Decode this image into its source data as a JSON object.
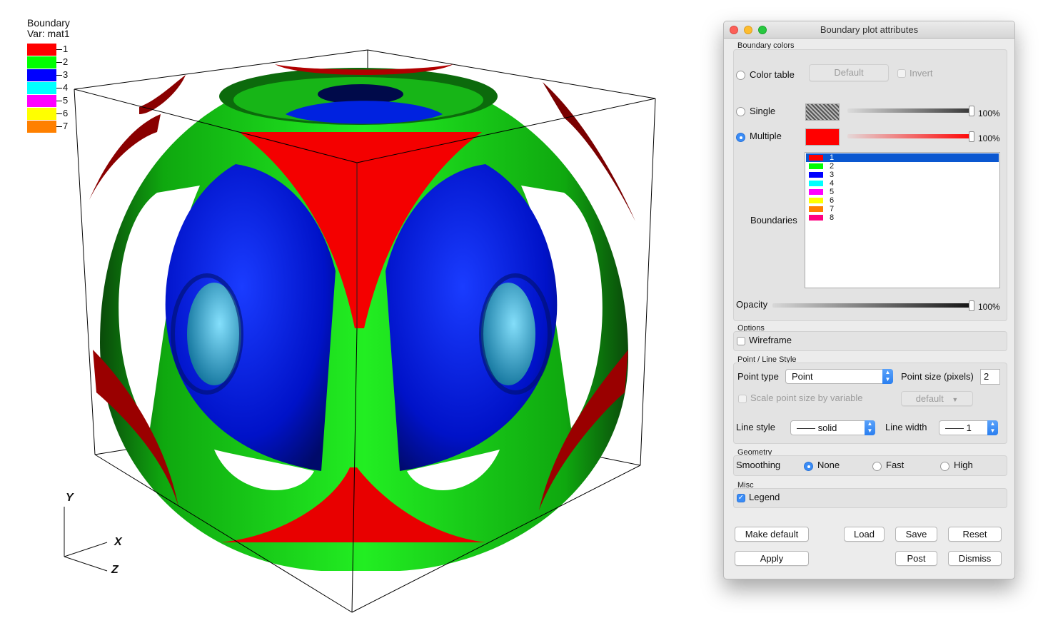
{
  "legend": {
    "title": "Boundary",
    "variable": "Var: mat1",
    "entries": [
      {
        "label": "1",
        "color": "#ff0000"
      },
      {
        "label": "2",
        "color": "#00ff00"
      },
      {
        "label": "3",
        "color": "#0000ff"
      },
      {
        "label": "4",
        "color": "#00ffff"
      },
      {
        "label": "5",
        "color": "#ff00ff"
      },
      {
        "label": "6",
        "color": "#ffff00"
      },
      {
        "label": "7",
        "color": "#ff8000"
      }
    ]
  },
  "axes": {
    "y": "Y",
    "x": "X",
    "z": "Z"
  },
  "dialog": {
    "title": "Boundary plot attributes",
    "boundary_colors": {
      "group_title": "Boundary colors",
      "color_table_label": "Color table",
      "color_table_value": "Default",
      "invert_label": "Invert",
      "single_label": "Single",
      "single_opacity": "100%",
      "multiple_label": "Multiple",
      "multiple_color": "#ff0000",
      "multiple_opacity": "100%",
      "selected_mode": "Multiple",
      "boundaries_label": "Boundaries",
      "boundaries": [
        {
          "label": "1",
          "color": "#ff0000",
          "selected": true
        },
        {
          "label": "2",
          "color": "#00ff00",
          "selected": false
        },
        {
          "label": "3",
          "color": "#0000ff",
          "selected": false
        },
        {
          "label": "4",
          "color": "#00ffff",
          "selected": false
        },
        {
          "label": "5",
          "color": "#ff00ff",
          "selected": false
        },
        {
          "label": "6",
          "color": "#ffff00",
          "selected": false
        },
        {
          "label": "7",
          "color": "#ff8000",
          "selected": false
        },
        {
          "label": "8",
          "color": "#ff0080",
          "selected": false
        }
      ],
      "opacity_label": "Opacity",
      "opacity_value": "100%"
    },
    "options": {
      "group_title": "Options",
      "wireframe_label": "Wireframe",
      "wireframe_checked": false
    },
    "point_line": {
      "group_title": "Point / Line Style",
      "point_type_label": "Point type",
      "point_type_value": "Point",
      "point_size_label": "Point size (pixels)",
      "point_size_value": "2",
      "scale_label": "Scale point size by variable",
      "scale_variable": "default",
      "line_style_label": "Line style",
      "line_style_value": "—— solid",
      "line_width_label": "Line width",
      "line_width_value": "—— 1"
    },
    "geometry": {
      "group_title": "Geometry",
      "smoothing_label": "Smoothing",
      "none_label": "None",
      "fast_label": "Fast",
      "high_label": "High",
      "selected": "None"
    },
    "misc": {
      "group_title": "Misc",
      "legend_label": "Legend",
      "legend_checked": true
    },
    "buttons": {
      "make_default": "Make default",
      "load": "Load",
      "save": "Save",
      "reset": "Reset",
      "apply": "Apply",
      "post": "Post",
      "dismiss": "Dismiss"
    }
  }
}
